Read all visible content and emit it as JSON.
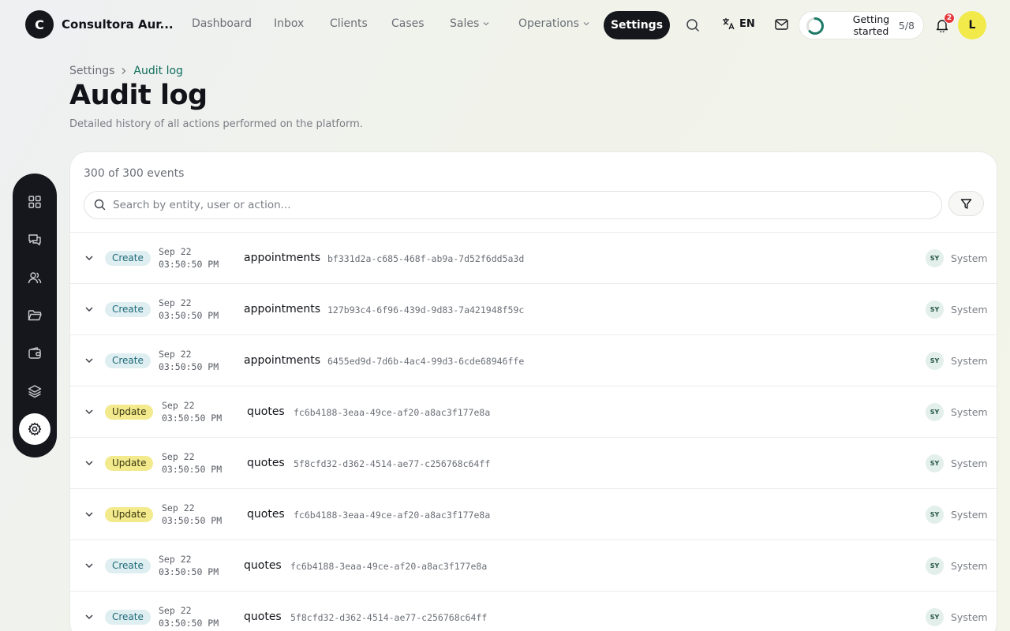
{
  "app": {
    "logo_letter": "C",
    "brand": "Consultora Aur..."
  },
  "nav": {
    "items": [
      "Dashboard",
      "Inbox",
      "Clients",
      "Cases"
    ],
    "sales": "Sales",
    "operations": "Operations",
    "active": "Settings",
    "lang": "EN",
    "getting_started": {
      "label": "Getting started",
      "count": "5/8",
      "progress": 0.625
    },
    "notifications": "2",
    "avatar": "L"
  },
  "breadcrumb": {
    "root": "Settings",
    "current": "Audit log"
  },
  "page": {
    "title": "Audit log",
    "subtitle": "Detailed history of all actions performed on the platform."
  },
  "sidebar": {
    "icons": [
      "grid-icon",
      "chat-icon",
      "users-icon",
      "folder-icon",
      "wallet-icon",
      "layers-icon",
      "settings-icon"
    ],
    "active": "settings-icon"
  },
  "log": {
    "count": "300 of 300 events",
    "search_placeholder": "Search by entity, user or action...",
    "rows": [
      {
        "action": "Create",
        "date": "Sep 22",
        "time": "03:50:50 PM",
        "entity": "appointments",
        "id": "bf331d2a-c685-468f-ab9a-7d52f6dd5a3d",
        "actor_initials": "SY",
        "actor": "System"
      },
      {
        "action": "Create",
        "date": "Sep 22",
        "time": "03:50:50 PM",
        "entity": "appointments",
        "id": "127b93c4-6f96-439d-9d83-7a421948f59c",
        "actor_initials": "SY",
        "actor": "System"
      },
      {
        "action": "Create",
        "date": "Sep 22",
        "time": "03:50:50 PM",
        "entity": "appointments",
        "id": "6455ed9d-7d6b-4ac4-99d3-6cde68946ffe",
        "actor_initials": "SY",
        "actor": "System"
      },
      {
        "action": "Update",
        "date": "Sep 22",
        "time": "03:50:50 PM",
        "entity": "quotes",
        "id": "fc6b4188-3eaa-49ce-af20-a8ac3f177e8a",
        "actor_initials": "SY",
        "actor": "System"
      },
      {
        "action": "Update",
        "date": "Sep 22",
        "time": "03:50:50 PM",
        "entity": "quotes",
        "id": "5f8cfd32-d362-4514-ae77-c256768c64ff",
        "actor_initials": "SY",
        "actor": "System"
      },
      {
        "action": "Update",
        "date": "Sep 22",
        "time": "03:50:50 PM",
        "entity": "quotes",
        "id": "fc6b4188-3eaa-49ce-af20-a8ac3f177e8a",
        "actor_initials": "SY",
        "actor": "System"
      },
      {
        "action": "Create",
        "date": "Sep 22",
        "time": "03:50:50 PM",
        "entity": "quotes",
        "id": "fc6b4188-3eaa-49ce-af20-a8ac3f177e8a",
        "actor_initials": "SY",
        "actor": "System"
      },
      {
        "action": "Create",
        "date": "Sep 22",
        "time": "03:50:50 PM",
        "entity": "quotes",
        "id": "5f8cfd32-d362-4514-ae77-c256768c64ff",
        "actor_initials": "SY",
        "actor": "System"
      }
    ]
  },
  "colors": {
    "accent": "#0e6e5c",
    "dark": "#15171c",
    "create_badge": "#dfeef0",
    "update_badge": "#f2ea8c",
    "avatar": "#f2e94a"
  }
}
